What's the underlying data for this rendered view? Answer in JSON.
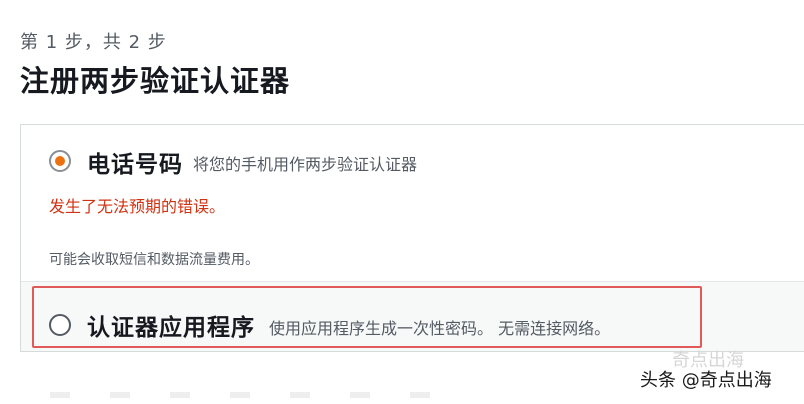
{
  "header": {
    "step": "第 1 步，共 2 步",
    "title": "注册两步验证认证器"
  },
  "options": {
    "phone": {
      "selected": true,
      "title": "电话号码",
      "description": "将您的手机用作两步验证认证器",
      "error": "发生了无法预期的错误。",
      "fee_note": "可能会收取短信和数据流量费用。"
    },
    "app": {
      "selected": false,
      "title": "认证器应用程序",
      "description": "使用应用程序生成一次性密码。 无需连接网络。"
    }
  },
  "watermark": {
    "top": "奇点出海",
    "text": "头条 @奇点出海"
  },
  "colors": {
    "accent": "#ec7211",
    "error": "#d13212",
    "highlight": "#e05a5a"
  }
}
